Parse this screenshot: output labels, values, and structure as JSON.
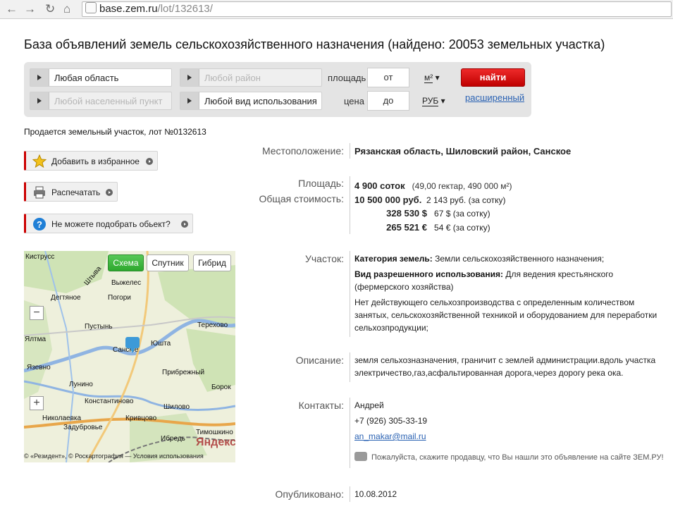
{
  "browser": {
    "url_host": "base.zem.ru",
    "url_path": "/lot/132613/"
  },
  "page_title": "База объявлений земель сельскохозяйственного назначения (найдено: 20053 земельных участка)",
  "filters": {
    "region": "Любая область",
    "district": "Любой район",
    "locality": "Любой населенный пункт",
    "usage": "Любой вид использования",
    "area_label": "площадь",
    "price_label": "цена",
    "from": "от",
    "to": "до",
    "area_unit": "м²",
    "price_unit": "РУБ",
    "search_button": "найти",
    "advanced_link": "расширенный"
  },
  "lot_title": "Продается земельный участок, лот №0132613",
  "actions": {
    "favorite": "Добавить в избранное",
    "print": "Распечатать",
    "help": "Не можете подобрать обьект?"
  },
  "map": {
    "tabs": [
      "Схема",
      "Спутник",
      "Гибрид"
    ],
    "zoom_out": "−",
    "zoom_in": "+",
    "brand": "Яндекс",
    "copyright": "© «Резидент», © Роскартография — Условия использования",
    "places": [
      "Киструсс",
      "Штыва",
      "Выжелес",
      "Дегтяное",
      "Погори",
      "Пустынь",
      "Терехово",
      "Ялтма",
      "Юшта",
      "Сансюе",
      "Язевно",
      "Прибрежный",
      "Лунино",
      "Борок",
      "Константиново",
      "Шилово",
      "Николаевка",
      "Кривцово",
      "Задубровье",
      "Ибредь",
      "Тимошкино"
    ]
  },
  "details": {
    "location_label": "Местоположение:",
    "location": "Рязанская область, Шиловский район, Санское",
    "area_label": "Площадь:",
    "area_main": "4 900 соток",
    "area_extra": "(49,00 гектар, 490 000 м²)",
    "price_label": "Общая стоимость:",
    "prices": [
      {
        "amount": "10 500 000 руб.",
        "per": "2 143 руб. (за сотку)"
      },
      {
        "amount": "328 530 $",
        "per": "67 $ (за сотку)"
      },
      {
        "amount": "265 521 €",
        "per": "54 € (за сотку)"
      }
    ],
    "plot_label": "Участок:",
    "category_label": "Категория земель:",
    "category": "Земли сельскохозяйственного назначения;",
    "permitted_label": "Вид разрешенного использования:",
    "permitted_1": "Для ведения крестьянского",
    "permitted_2": "(фермерского хозяйства)",
    "extra_1": "Нет действующего сельхозпроизводства с определенным количеством",
    "extra_2": "занятых, сельскохозяйственной техникой и оборудованием для переработки",
    "extra_3": "сельхозпродукции;",
    "desc_label": "Описание:",
    "desc_1": "земля сельхозназначения, граничит с землей администрации.вдоль участка",
    "desc_2": "электричество,газ,асфальтированная дорога,через дорогу река ока.",
    "contacts_label": "Контакты:",
    "contact_name": "Андрей",
    "contact_phone": "+7 (926) 305-33-19",
    "contact_email": "an_makar@mail.ru",
    "hint": "Пожалуйста, скажите продавцу, что Вы нашли это объявление на сайте ЗЕМ.РУ!",
    "published_label": "Опубликовано:",
    "published": "10.08.2012"
  }
}
